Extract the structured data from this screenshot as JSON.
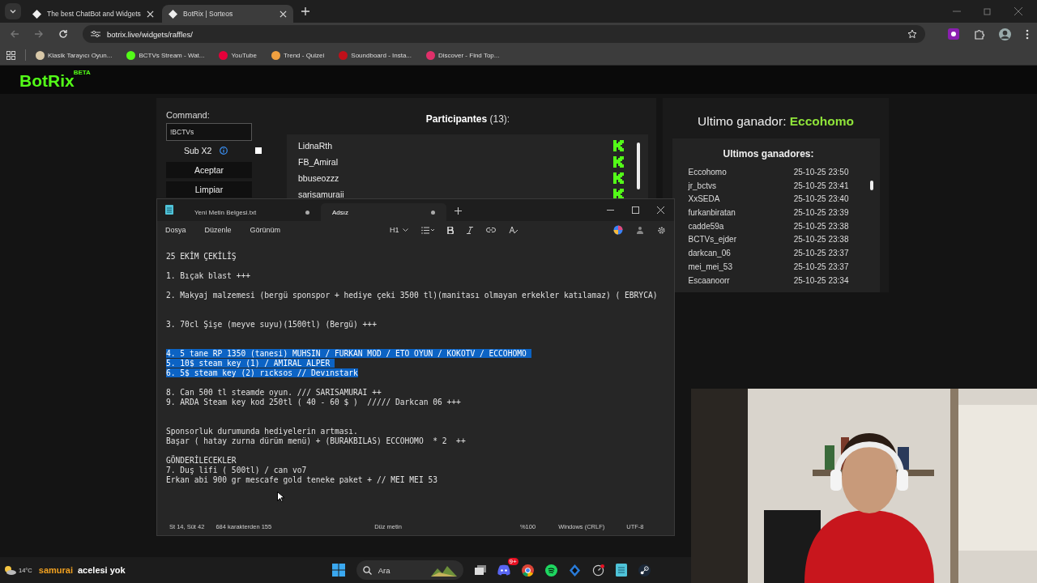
{
  "browser": {
    "tabs": [
      {
        "title": "The best ChatBot and Widgets",
        "selected": false
      },
      {
        "title": "BotRix | Sorteos",
        "selected": true
      }
    ],
    "url": "botrix.live/widgets/raffles/",
    "bookmarks": [
      "Klasik Tarayıcı Oyun...",
      "BCTVs Stream - Wat...",
      "YouTube",
      "Trend - Quizei",
      "Soundboard - Insta...",
      "Discover - Find Top..."
    ]
  },
  "site": {
    "logo": "BotRix",
    "badge": "BETA"
  },
  "controls": {
    "command_label": "Command:",
    "command_value": "!BCTVs",
    "sub_label": "Sub X2",
    "sub_checked": false,
    "accept": "Aceptar",
    "clear": "Limpiar"
  },
  "participants": {
    "title": "Participantes",
    "count": "(13):",
    "items": [
      "LidnaRth",
      "FB_Amiral",
      "bbuseozzz",
      "sarisamuraii"
    ]
  },
  "winner": {
    "label": "Ultimo ganador:",
    "name": "Eccohomo"
  },
  "winners": {
    "title": "Ultimos ganadores:",
    "rows": [
      {
        "name": "Eccohomo",
        "time": "25-10-25 23:50"
      },
      {
        "name": "jr_bctvs",
        "time": "25-10-25 23:41"
      },
      {
        "name": "XxSEDA",
        "time": "25-10-25 23:40"
      },
      {
        "name": "furkanbiratan",
        "time": "25-10-25 23:39"
      },
      {
        "name": "cadde59a",
        "time": "25-10-25 23:38"
      },
      {
        "name": "BCTVs_ejder",
        "time": "25-10-25 23:38"
      },
      {
        "name": "darkcan_06",
        "time": "25-10-25 23:37"
      },
      {
        "name": "mei_mei_53",
        "time": "25-10-25 23:37"
      },
      {
        "name": "Escaanoorr",
        "time": "25-10-25 23:34"
      }
    ]
  },
  "notepad": {
    "tabs": [
      {
        "title": "Yeni Metin Belgesi.txt",
        "selected": false,
        "unsaved": true
      },
      {
        "title": "Adsız",
        "selected": true,
        "unsaved": true
      }
    ],
    "menu": [
      "Dosya",
      "Düzenle",
      "Görünüm"
    ],
    "heading": "H1",
    "lines": [
      {
        "kind": "blank"
      },
      {
        "kind": "text",
        "text": "25 EKİM ÇEKİLİŞ",
        "selected": false
      },
      {
        "kind": "blank"
      },
      {
        "kind": "text",
        "text": "1. Bıçak blast +++",
        "selected": false
      },
      {
        "kind": "blank"
      },
      {
        "kind": "text",
        "text": "2. Makyaj malzemesi (bergü sponspor + hediye çeki 3500 tl)(manitası olmayan erkekler katılamaz) ( EBRYCA)",
        "selected": false
      },
      {
        "kind": "blank"
      },
      {
        "kind": "blank"
      },
      {
        "kind": "text",
        "text": "3. 70cl Şişe (meyve suyu)(1500tl) (Bergü) +++",
        "selected": false
      },
      {
        "kind": "blank"
      },
      {
        "kind": "blank"
      },
      {
        "kind": "text",
        "text": "4. 5 tane RP 1350 (tanesi) MUHSIN / FURKAN MOD / ETO OYUN / KOKOTV / ECCOHOMO ",
        "selected": true
      },
      {
        "kind": "text",
        "text": "5. 10$ steam key (1) / AMIRAL ALPER ",
        "selected": true
      },
      {
        "kind": "text",
        "text": "6. 5$ steam key (2) rıcksos // Devınstark",
        "selected": true
      },
      {
        "kind": "blank"
      },
      {
        "kind": "text",
        "text": "8. Can 500 tl steamde oyun. /// SARISAMURAI ++",
        "selected": false
      },
      {
        "kind": "text",
        "text": "9. ARDA Steam key kod 250tl ( 40 - 60 $ )  ///// Darkcan 06 +++",
        "selected": false
      },
      {
        "kind": "blank"
      },
      {
        "kind": "blank"
      },
      {
        "kind": "text",
        "text": "Sponsorluk durumunda hediyelerin artması.",
        "selected": false
      },
      {
        "kind": "text",
        "text": "Başar ( hatay zurna dürüm menü) + (BURAKBILAS) ECCOHOMO  * 2  ++",
        "selected": false
      },
      {
        "kind": "blank"
      },
      {
        "kind": "text",
        "text": "GÖNDERİLECEKLER",
        "selected": false
      },
      {
        "kind": "text",
        "text": "7. Duş lifi ( 500tl) / can vo7",
        "selected": false
      },
      {
        "kind": "text",
        "text": "Erkan abi 900 gr mescafe gold teneke paket + // MEI MEI 53",
        "selected": false
      }
    ],
    "status": {
      "position": "St 14, Süt 42",
      "chars": "684 karakterden 155",
      "format": "Düz metin",
      "zoom": "%100",
      "eol": "Windows (CRLF)",
      "encoding": "UTF-8"
    }
  },
  "overlay": {
    "name": "samurai",
    "message": "acelesi yok"
  },
  "taskbar": {
    "temperature": "14°C",
    "search": "Ara",
    "discord_badge": "9+"
  }
}
